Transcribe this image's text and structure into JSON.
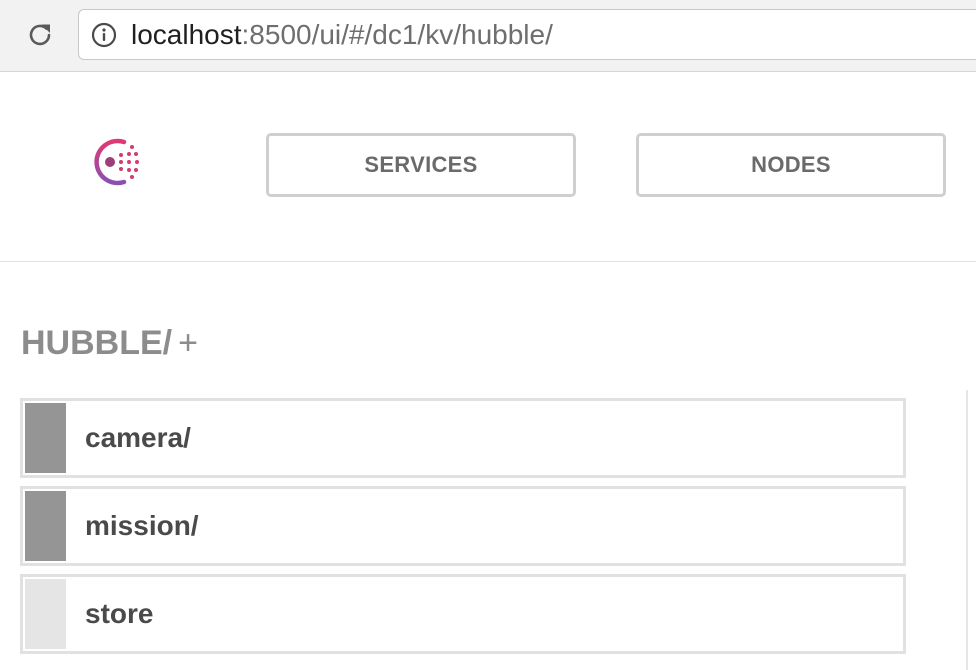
{
  "browser": {
    "url_host": "localhost",
    "url_rest": ":8500/ui/#/dc1/kv/hubble/"
  },
  "nav": {
    "services_label": "SERVICES",
    "nodes_label": "NODES"
  },
  "page": {
    "title": "HUBBLE/",
    "add_label": "+"
  },
  "kv_items": [
    {
      "label": "camera/",
      "type": "folder",
      "marker_color": "#959595"
    },
    {
      "label": "mission/",
      "type": "folder",
      "marker_color": "#959595"
    },
    {
      "label": "store",
      "type": "key",
      "marker_color": "#e5e5e5"
    }
  ],
  "colors": {
    "logo_gradient_start": "#e03875",
    "logo_gradient_end": "#8b4fb3",
    "border": "#e1e1e1",
    "title": "#8c8c8c"
  },
  "icons": {
    "reload": "reload-icon",
    "info": "info-icon",
    "logo": "consul-logo"
  }
}
